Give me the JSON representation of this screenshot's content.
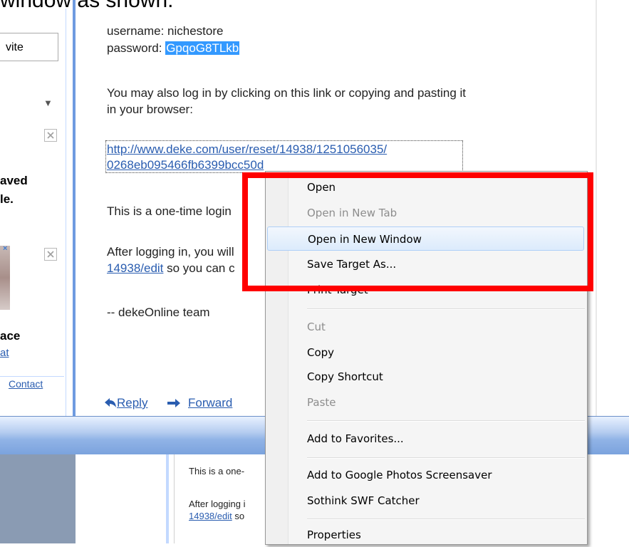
{
  "caption": "window as shown.",
  "sidebar": {
    "box_text": "vite",
    "dropdown_glyph": "▼",
    "frag_line1": "aved",
    "frag_line2": "le.",
    "frag_line3": "ace",
    "frag_link": "at",
    "contact_link": "Contact"
  },
  "message": {
    "username_line": "username: nichestore",
    "password_label": "password: ",
    "password_value": "GpqoG8TLkb",
    "also_line1": "You may also log in by clicking on this link or copying and pasting it",
    "also_line2": "in your browser:",
    "reset_link_line1": "http://www.deke.com/user/reset/14938/1251056035/",
    "reset_link_line2": "0268eb095466fb6399bcc50d",
    "onetime_text": "This is a one-time login",
    "after_text": "After logging in, you will",
    "edit_link": "14938/edit",
    "edit_after": " so you can c",
    "signature": "-- dekeOnline team"
  },
  "actions": {
    "reply_label": "Reply",
    "forward_label": "Forward"
  },
  "lower": {
    "line1": "This is a one-",
    "line2": "After logging i",
    "link": "14938/edit",
    "link_after": " so"
  },
  "context_menu": {
    "items": [
      {
        "label": "Open",
        "state": "enabled"
      },
      {
        "label": "Open in New Tab",
        "state": "disabled"
      },
      {
        "label": "Open in New Window",
        "state": "hover"
      },
      {
        "label": "Save Target As...",
        "state": "enabled"
      },
      {
        "label": "Print Target",
        "state": "enabled"
      },
      {
        "label": "Cut",
        "state": "disabled"
      },
      {
        "label": "Copy",
        "state": "enabled"
      },
      {
        "label": "Copy Shortcut",
        "state": "enabled"
      },
      {
        "label": "Paste",
        "state": "disabled"
      },
      {
        "label": "Add to Favorites...",
        "state": "enabled"
      },
      {
        "label": "Add to Google Photos Screensaver",
        "state": "enabled"
      },
      {
        "label": "Sothink SWF Catcher",
        "state": "enabled"
      },
      {
        "label": "Properties",
        "state": "enabled"
      }
    ]
  },
  "colors": {
    "highlight": "#ff0000",
    "link": "#2a5db0",
    "selection": "#3399ff",
    "menu_hover": "#dcebfc"
  }
}
